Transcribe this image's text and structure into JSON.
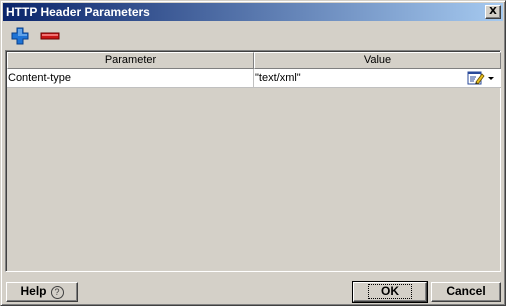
{
  "window": {
    "title": "HTTP Header Parameters",
    "close_label": "X"
  },
  "toolbar": {
    "add_icon": "plus-icon",
    "remove_icon": "minus-icon"
  },
  "table": {
    "columns": [
      "Parameter",
      "Value"
    ],
    "rows": [
      {
        "parameter": "Content-type",
        "value": "\"text/xml\""
      }
    ]
  },
  "footer": {
    "help_label": "Help",
    "help_icon": "question-icon",
    "help_icon_glyph": "?",
    "ok_label": "OK",
    "cancel_label": "Cancel"
  },
  "colors": {
    "title_start": "#0a246a",
    "title_end": "#a6caf0",
    "face": "#d4d0c8",
    "add": "#1e73d6",
    "remove": "#c81414"
  }
}
